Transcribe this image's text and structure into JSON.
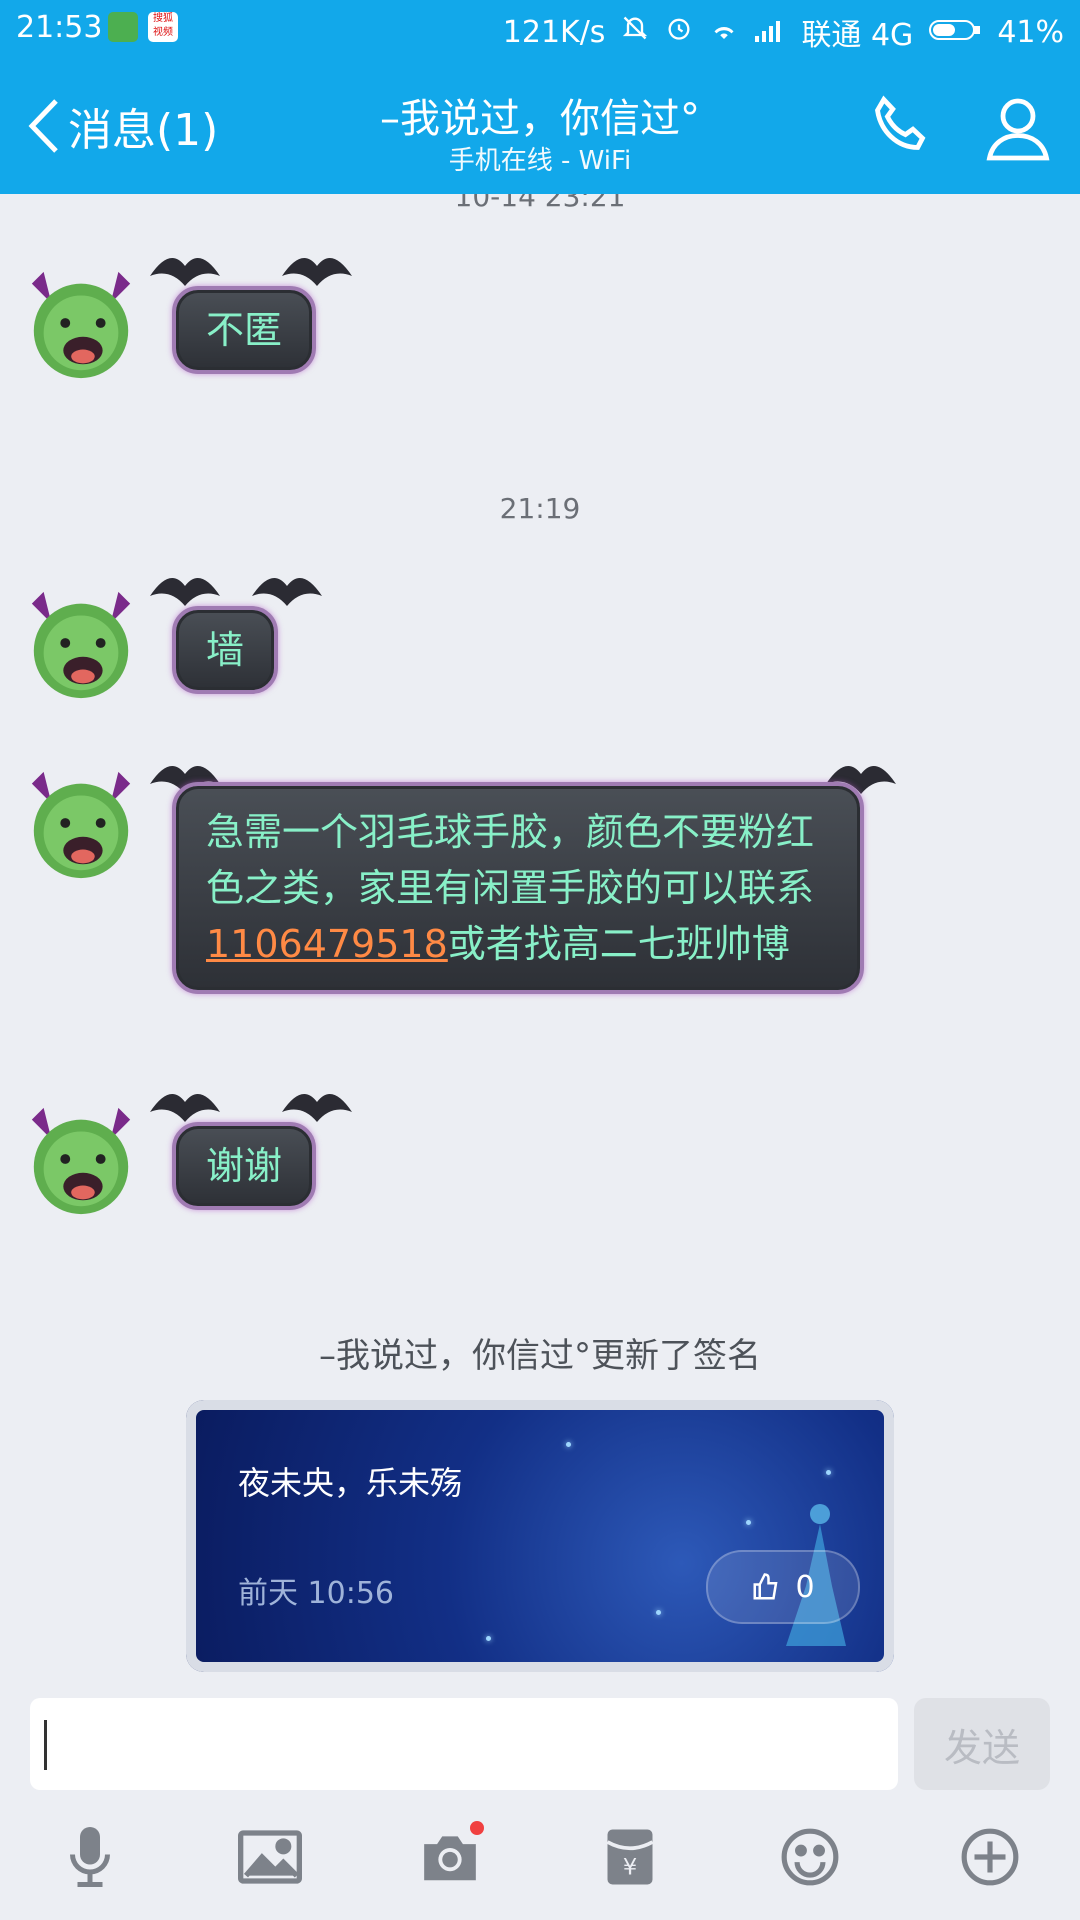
{
  "status_bar": {
    "time": "21:53",
    "app_badge_text": "搜狐 视频",
    "network_speed": "121K/s",
    "carrier": "联通 4G",
    "battery": "41%"
  },
  "header": {
    "back_label": "消息(1)",
    "contact_name": "–我说过，你信过°",
    "contact_status": "手机在线 - WiFi",
    "accent_color": "#12a8ea"
  },
  "chat": {
    "cutoff_timestamp": "10-14 23:21",
    "timestamp_2": "21:19",
    "messages": [
      {
        "text": "不匿"
      },
      {
        "text": "墙"
      },
      {
        "text_before_link": "急需一个羽毛球手胶，颜色不要粉红色之类，家里有闲置手胶的可以联系",
        "link": "1106479518",
        "text_after_link": "或者找高二七班帅博"
      },
      {
        "text": "谢谢"
      }
    ],
    "system_message": "–我说过，你信过°更新了签名",
    "signature_card": {
      "text": "夜未央，乐未殇",
      "date": "前天 10:56",
      "like_count": "0"
    }
  },
  "input": {
    "value": "",
    "send_label": "发送"
  },
  "toolbar": {
    "icons": [
      "microphone-icon",
      "image-icon",
      "camera-icon",
      "red-packet-icon",
      "emoji-icon",
      "plus-icon"
    ]
  }
}
